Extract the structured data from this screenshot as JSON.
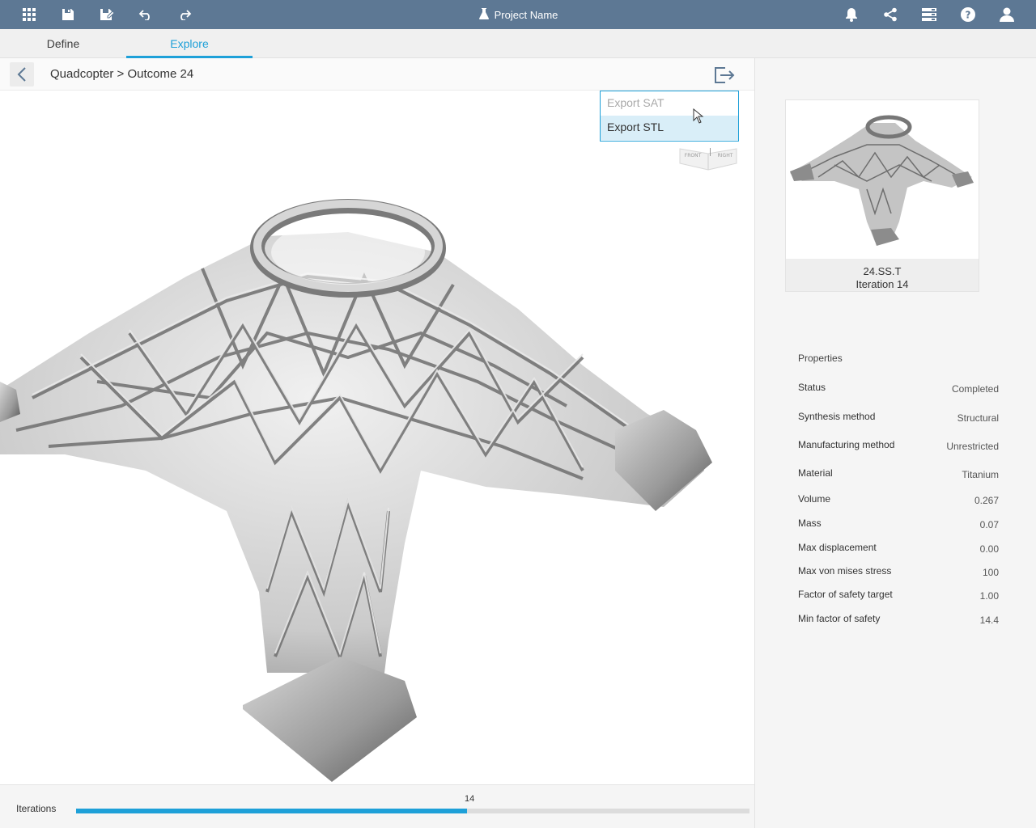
{
  "header": {
    "project_name": "Project Name"
  },
  "tabs": [
    {
      "label": "Define",
      "active": false
    },
    {
      "label": "Explore",
      "active": true
    }
  ],
  "breadcrumb": "Quadcopter > Outcome 24",
  "export_menu": {
    "items": [
      {
        "label": "Export SAT",
        "disabled": true
      },
      {
        "label": "Export STL",
        "disabled": false
      }
    ]
  },
  "viewcube": {
    "front": "FRONT",
    "right": "RIGHT"
  },
  "outcome_card": {
    "name": "24.SS.T",
    "iteration": "Iteration 14"
  },
  "properties": {
    "title": "Properties",
    "rows": [
      {
        "key": "Status",
        "value": "Completed"
      },
      {
        "key": "Synthesis method",
        "value": "Structural"
      },
      {
        "key": "Manufacturing method",
        "value": "Unrestricted"
      },
      {
        "key": "Material",
        "value": "Titanium"
      },
      {
        "key": "Volume",
        "value": "0.267"
      },
      {
        "key": "Mass",
        "value": "0.07"
      },
      {
        "key": "Max displacement",
        "value": "0.00"
      },
      {
        "key": "Max von mises stress",
        "value": "100"
      },
      {
        "key": "Factor of safety target",
        "value": "1.00"
      },
      {
        "key": "Min factor of safety",
        "value": "14.4"
      }
    ]
  },
  "iterations": {
    "label": "Iterations",
    "current": "14",
    "progress_fraction": 0.58
  },
  "colors": {
    "topbar": "#5d7894",
    "accent": "#1ea0d8"
  }
}
